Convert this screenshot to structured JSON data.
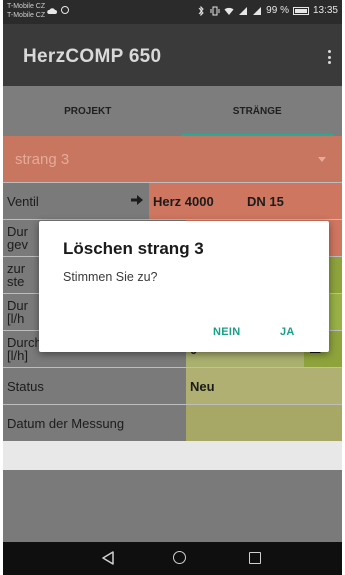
{
  "statusbar": {
    "carrier1": "T-Mobile CZ",
    "carrier2": "T-Mobile CZ",
    "battery": "99 %",
    "time": "13:35"
  },
  "toolbar": {
    "title": "HerzCOMP 650"
  },
  "tabs": [
    {
      "label": "PROJEKT",
      "active": false
    },
    {
      "label": "STRÄNGE",
      "active": true
    }
  ],
  "spinner": {
    "selected": "strang 3"
  },
  "table": {
    "ventil": {
      "label": "Ventil",
      "value": "Herz 4000",
      "dn": "DN 15"
    },
    "row2": {
      "label_line1": "Dur",
      "label_line2": "gev"
    },
    "row3": {
      "label_line1": "zur",
      "label_line2": "ste"
    },
    "row4": {
      "label_line1": "Dur",
      "label_line2": "[l/h"
    },
    "flow_actual": {
      "label_line1": "Durchfluss tatsächlich",
      "label_line2": "[l/h]",
      "value": "0"
    },
    "status": {
      "label": "Status",
      "value": "Neu"
    },
    "date": {
      "label": "Datum der Messung",
      "value": ""
    }
  },
  "dialog": {
    "title": "Löschen strang 3",
    "message": "Stimmen Sie zu?",
    "no_label": "NEIN",
    "yes_label": "JA"
  },
  "colors": {
    "accent": "#1aa087",
    "salmon": "#cf7661",
    "green": "#8ea33c"
  }
}
